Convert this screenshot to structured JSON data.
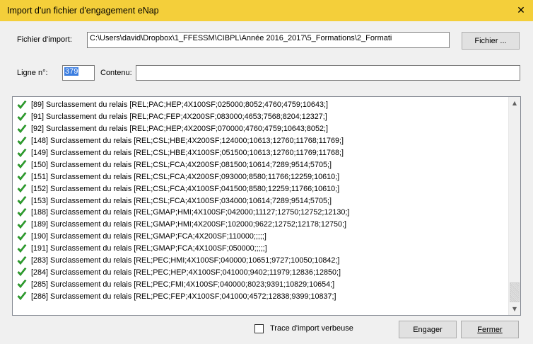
{
  "window": {
    "title": "Import d'un fichier d'engagement eNap",
    "close_glyph": "✕",
    "accent_color": "#f4cf3a"
  },
  "import": {
    "label": "Fichier d'import:",
    "path": "C:\\Users\\david\\Dropbox\\1_FFESSM\\CIBPL\\Année 2016_2017\\5_Formations\\2_Formati",
    "file_button": "Fichier ..."
  },
  "line": {
    "label": "Ligne n°:",
    "value": "379",
    "content_label": "Contenu:",
    "content_value": ""
  },
  "log": {
    "icon": "green-check-icon",
    "items": [
      "[89] Surclassement du relais [REL;PAC;HEP;4X100SF;025000;8052;4760;4759;10643;]",
      "[91] Surclassement du relais [REL;PAC;FEP;4X200SF;083000;4653;7568;8204;12327;]",
      "[92] Surclassement du relais [REL;PAC;HEP;4X200SF;070000;4760;4759;10643;8052;]",
      "[148] Surclassement du relais [REL;CSL;HBE;4X200SF;124000;10613;12760;11768;11769;]",
      "[149] Surclassement du relais [REL;CSL;HBE;4X100SF;051500;10613;12760;11769;11768;]",
      "[150] Surclassement du relais [REL;CSL;FCA;4X200SF;081500;10614;7289;9514;5705;]",
      "[151] Surclassement du relais [REL;CSL;FCA;4X200SF;093000;8580;11766;12259;10610;]",
      "[152] Surclassement du relais [REL;CSL;FCA;4X100SF;041500;8580;12259;11766;10610;]",
      "[153] Surclassement du relais [REL;CSL;FCA;4X100SF;034000;10614;7289;9514;5705;]",
      "[188] Surclassement du relais [REL;GMAP;HMI;4X100SF;042000;11127;12750;12752;12130;]",
      "[189] Surclassement du relais [REL;GMAP;HMI;4X200SF;102000;9622;12752;12178;12750;]",
      "[190] Surclassement du relais [REL;GMAP;FCA;4X200SF;110000;;;;;]",
      "[191] Surclassement du relais [REL;GMAP;FCA;4X100SF;050000;;;;;]",
      "[283] Surclassement du relais [REL;PEC;HMI;4X100SF;040000;10651;9727;10050;10842;]",
      "[284] Surclassement du relais [REL;PEC;HEP;4X100SF;041000;9402;11979;12836;12850;]",
      "[285] Surclassement du relais [REL;PEC;FMI;4X100SF;040000;8023;9391;10829;10654;]",
      "[286] Surclassement du relais [REL;PEC;FEP;4X100SF;041000;4572;12838;9399;10837;]"
    ]
  },
  "footer": {
    "verbose_label": "Trace d'import verbeuse",
    "verbose_checked": false,
    "engage_button": "Engager",
    "close_button": "Fermer"
  }
}
